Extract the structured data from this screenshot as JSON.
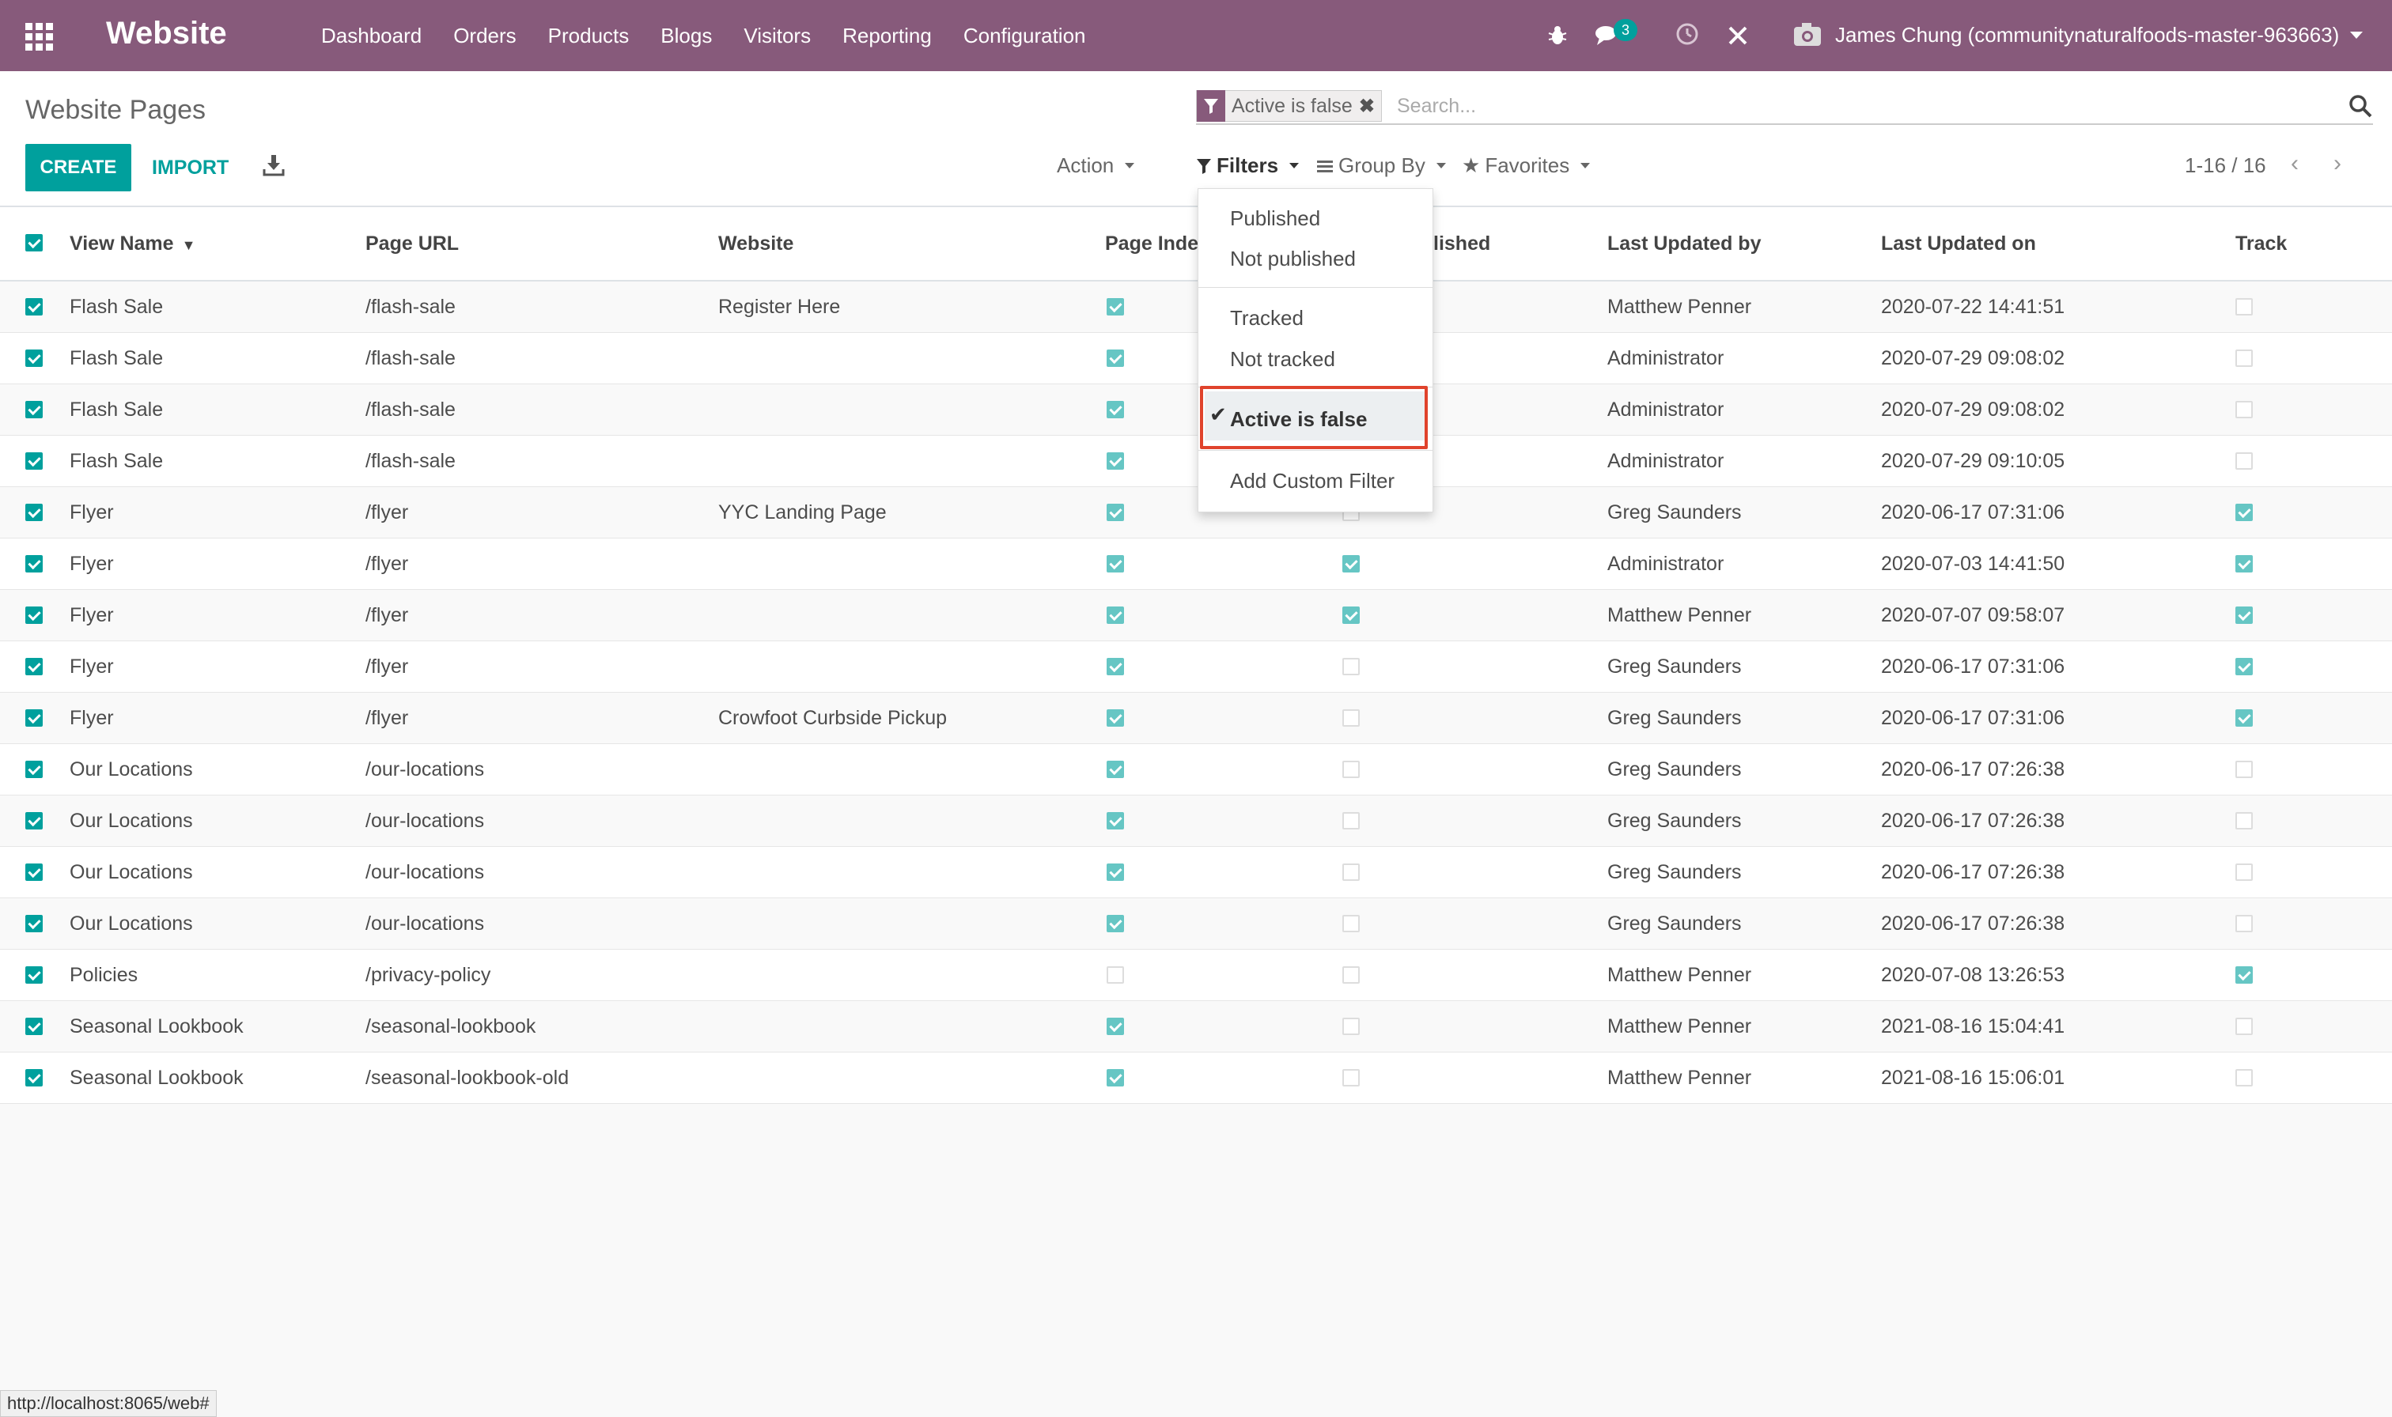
{
  "navbar": {
    "brand": "Website",
    "menu": [
      "Dashboard",
      "Orders",
      "Products",
      "Blogs",
      "Visitors",
      "Reporting",
      "Configuration"
    ],
    "messages_count": "3",
    "user": "James Chung (communitynaturalfoods-master-963663)",
    "color": "#875a7b"
  },
  "control": {
    "title": "Website Pages",
    "create_label": "CREATE",
    "import_label": "IMPORT",
    "action_label": "Action",
    "filters_label": "Filters",
    "groupby_label": "Group By",
    "favorites_label": "Favorites",
    "pager": "1-16 / 16",
    "accent": "#00a09d"
  },
  "search": {
    "facet": "Active is false",
    "placeholder": "Search..."
  },
  "filters_menu": {
    "items": [
      "Published",
      "Not published",
      "Tracked",
      "Not tracked",
      "Active is false",
      "Add Custom Filter"
    ],
    "active_item": "Active is false"
  },
  "table": {
    "columns": [
      "View Name",
      "Page URL",
      "Website",
      "Page Inde",
      "lished",
      "Last Updated by",
      "Last Updated on",
      "Track"
    ],
    "rows": [
      {
        "name": "Flash Sale",
        "url": "/flash-sale",
        "website": "Register Here",
        "indexed": true,
        "published": null,
        "updated_by": "Matthew Penner",
        "updated_on": "2020-07-22 14:41:51",
        "track": false
      },
      {
        "name": "Flash Sale",
        "url": "/flash-sale",
        "website": "",
        "indexed": true,
        "published": null,
        "updated_by": "Administrator",
        "updated_on": "2020-07-29 09:08:02",
        "track": false
      },
      {
        "name": "Flash Sale",
        "url": "/flash-sale",
        "website": "",
        "indexed": true,
        "published": null,
        "updated_by": "Administrator",
        "updated_on": "2020-07-29 09:08:02",
        "track": false
      },
      {
        "name": "Flash Sale",
        "url": "/flash-sale",
        "website": "",
        "indexed": true,
        "published": null,
        "updated_by": "Administrator",
        "updated_on": "2020-07-29 09:10:05",
        "track": false
      },
      {
        "name": "Flyer",
        "url": "/flyer",
        "website": "YYC Landing Page",
        "indexed": true,
        "published": false,
        "updated_by": "Greg Saunders",
        "updated_on": "2020-06-17 07:31:06",
        "track": true
      },
      {
        "name": "Flyer",
        "url": "/flyer",
        "website": "",
        "indexed": true,
        "published": true,
        "updated_by": "Administrator",
        "updated_on": "2020-07-03 14:41:50",
        "track": true
      },
      {
        "name": "Flyer",
        "url": "/flyer",
        "website": "",
        "indexed": true,
        "published": true,
        "updated_by": "Matthew Penner",
        "updated_on": "2020-07-07 09:58:07",
        "track": true
      },
      {
        "name": "Flyer",
        "url": "/flyer",
        "website": "",
        "indexed": true,
        "published": false,
        "updated_by": "Greg Saunders",
        "updated_on": "2020-06-17 07:31:06",
        "track": true
      },
      {
        "name": "Flyer",
        "url": "/flyer",
        "website": "Crowfoot Curbside Pickup",
        "indexed": true,
        "published": false,
        "updated_by": "Greg Saunders",
        "updated_on": "2020-06-17 07:31:06",
        "track": true
      },
      {
        "name": "Our Locations",
        "url": "/our-locations",
        "website": "",
        "indexed": true,
        "published": false,
        "updated_by": "Greg Saunders",
        "updated_on": "2020-06-17 07:26:38",
        "track": false
      },
      {
        "name": "Our Locations",
        "url": "/our-locations",
        "website": "",
        "indexed": true,
        "published": false,
        "updated_by": "Greg Saunders",
        "updated_on": "2020-06-17 07:26:38",
        "track": false
      },
      {
        "name": "Our Locations",
        "url": "/our-locations",
        "website": "",
        "indexed": true,
        "published": false,
        "updated_by": "Greg Saunders",
        "updated_on": "2020-06-17 07:26:38",
        "track": false
      },
      {
        "name": "Our Locations",
        "url": "/our-locations",
        "website": "",
        "indexed": true,
        "published": false,
        "updated_by": "Greg Saunders",
        "updated_on": "2020-06-17 07:26:38",
        "track": false
      },
      {
        "name": "Policies",
        "url": "/privacy-policy",
        "website": "",
        "indexed": false,
        "published": false,
        "updated_by": "Matthew Penner",
        "updated_on": "2020-07-08 13:26:53",
        "track": true
      },
      {
        "name": "Seasonal Lookbook",
        "url": "/seasonal-lookbook",
        "website": "",
        "indexed": true,
        "published": false,
        "updated_by": "Matthew Penner",
        "updated_on": "2021-08-16 15:04:41",
        "track": false
      },
      {
        "name": "Seasonal Lookbook",
        "url": "/seasonal-lookbook-old",
        "website": "",
        "indexed": true,
        "published": false,
        "updated_by": "Matthew Penner",
        "updated_on": "2021-08-16 15:06:01",
        "track": false
      }
    ]
  },
  "statusbar": "http://localhost:8065/web#"
}
